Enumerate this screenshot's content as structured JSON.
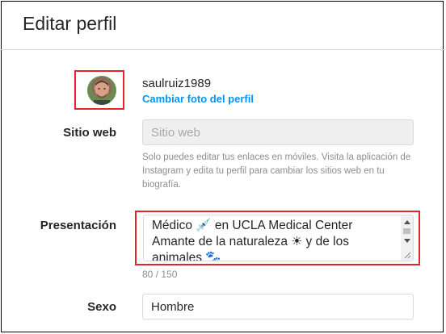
{
  "header": {
    "title": "Editar perfil"
  },
  "profile": {
    "username": "saulruiz1989",
    "change_photo_label": "Cambiar foto del perfil"
  },
  "website": {
    "label": "Sitio web",
    "placeholder": "Sitio web",
    "help_text": "Solo puedes editar tus enlaces en móviles. Visita la aplicación de Instagram y edita tu perfil para cambiar los sitios web en tu biografía."
  },
  "bio": {
    "label": "Presentación",
    "value": "Médico 💉 en UCLA Medical Center\nAmante de la naturaleza ☀ y de los animales 🐾",
    "counter": "80 / 150"
  },
  "gender": {
    "label": "Sexo",
    "value": "Hombre"
  },
  "colors": {
    "highlight_border": "#e0262a",
    "link_blue": "#0095f6",
    "text": "#262626",
    "muted": "#8e8e8e"
  }
}
